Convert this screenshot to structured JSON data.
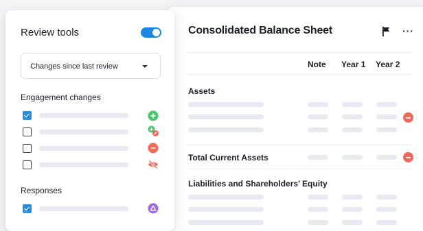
{
  "review_tools": {
    "title": "Review tools",
    "toggle_on": true,
    "dropdown_selected": "Changes since last review",
    "engagement_label": "Engagement changes",
    "engagement_rows": [
      {
        "checked": true,
        "icon": "plus-circle-icon"
      },
      {
        "checked": false,
        "icon": "add-edit-icon"
      },
      {
        "checked": false,
        "icon": "minus-circle-icon"
      },
      {
        "checked": false,
        "icon": "hidden-eye-icon"
      }
    ],
    "responses_label": "Responses",
    "responses_rows": [
      {
        "checked": true,
        "icon": "triangle-alert-icon"
      }
    ]
  },
  "balance_sheet": {
    "title": "Consolidated Balance Sheet",
    "columns": [
      "Note",
      "Year 1",
      "Year 2"
    ],
    "sections": {
      "assets": "Assets",
      "total_current_assets": "Total Current Assets",
      "liabilities": "Liabilities and Shareholders’ Equity"
    }
  },
  "colors": {
    "accent": "#1a87e6",
    "add_green": "#4cc76f",
    "remove_red": "#f06a5a",
    "response_purple": "#9b6be0",
    "placeholder_bar": "#e7eaf0"
  }
}
